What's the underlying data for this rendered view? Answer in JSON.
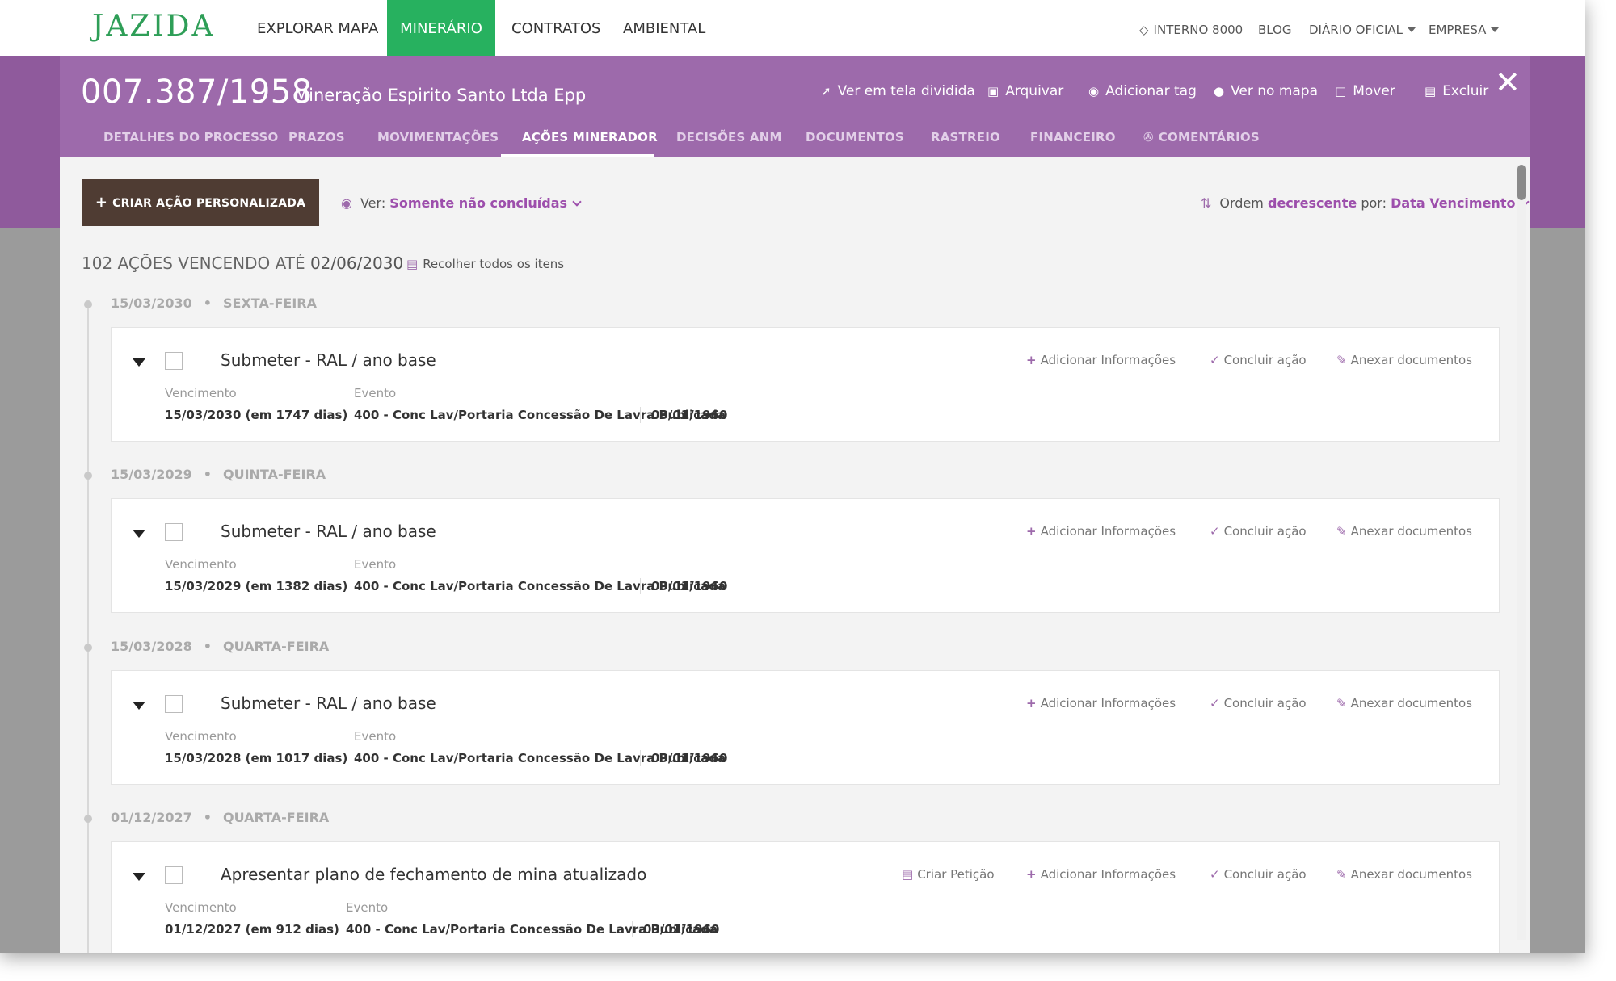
{
  "brand": {
    "logo": "JAZIDA"
  },
  "topnav": {
    "items": [
      {
        "label": "EXPLORAR MAPA"
      },
      {
        "label": "MINERÁRIO",
        "active": true
      },
      {
        "label": "CONTRATOS"
      },
      {
        "label": "AMBIENTAL"
      }
    ],
    "right": {
      "plan": "INTERNO 8000",
      "blog": "BLOG",
      "diario": "DIÁRIO OFICIAL",
      "empresa": "EMPRESA"
    }
  },
  "process": {
    "number": "007.387/1958",
    "company": "Mineração Espirito Santo Ltda Epp"
  },
  "header_actions": {
    "split": "Ver em tela dividida",
    "archive": "Arquivar",
    "tag": "Adicionar tag",
    "map": "Ver no mapa",
    "move": "Mover",
    "delete": "Excluir"
  },
  "tabs": [
    {
      "label": "DETALHES DO PROCESSO"
    },
    {
      "label": "PRAZOS"
    },
    {
      "label": "MOVIMENTAÇÕES"
    },
    {
      "label": "AÇÕES MINERADOR",
      "active": true
    },
    {
      "label": "DECISÕES ANM"
    },
    {
      "label": "DOCUMENTOS"
    },
    {
      "label": "RASTREIO"
    },
    {
      "label": "FINANCEIRO"
    },
    {
      "label": "COMENTÁRIOS"
    }
  ],
  "toolbar": {
    "create_button": "CRIAR AÇÃO PERSONALIZADA",
    "filter_label": "Ver:",
    "filter_value": "Somente não concluídas",
    "order_label": "Ordem",
    "order_direction": "decrescente",
    "order_by_label": "por:",
    "order_field": "Data Vencimento"
  },
  "summary": {
    "count_text": "102 AÇÕES VENCENDO ATÉ",
    "date": "02/06/2030",
    "collapse_all": "Recolher todos os itens"
  },
  "labels": {
    "vencimento": "Vencimento",
    "evento": "Evento",
    "add_info": "Adicionar Informações",
    "conclude": "Concluir ação",
    "attach": "Anexar documentos",
    "petition": "Criar Petição"
  },
  "groups": [
    {
      "date": "15/03/2030",
      "weekday": "SEXTA-FEIRA",
      "action": {
        "title": "Submeter - RAL / ano base",
        "due": "15/03/2030 (em 1747 dias)",
        "event": "400 - Conc Lav/Portaria Concessão De Lavra Publicada",
        "event_date": "03/01/1960"
      }
    },
    {
      "date": "15/03/2029",
      "weekday": "QUINTA-FEIRA",
      "action": {
        "title": "Submeter - RAL / ano base",
        "due": "15/03/2029 (em 1382 dias)",
        "event": "400 - Conc Lav/Portaria Concessão De Lavra Publicada",
        "event_date": "03/01/1960"
      }
    },
    {
      "date": "15/03/2028",
      "weekday": "QUARTA-FEIRA",
      "action": {
        "title": "Submeter - RAL / ano base",
        "due": "15/03/2028 (em 1017 dias)",
        "event": "400 - Conc Lav/Portaria Concessão De Lavra Publicada",
        "event_date": "03/01/1960"
      }
    },
    {
      "date": "01/12/2027",
      "weekday": "QUARTA-FEIRA",
      "action": {
        "title": "Apresentar plano de fechamento de mina atualizado",
        "due": "01/12/2027 (em 912 dias)",
        "event": "400 - Conc Lav/Portaria Concessão De Lavra Publicada",
        "event_date": "03/01/1960"
      }
    }
  ],
  "colors": {
    "brand_green": "#27b15f",
    "purple": "#9d6aab",
    "purple_dark": "#8f5a9c",
    "create_button": "#4f3c33"
  }
}
